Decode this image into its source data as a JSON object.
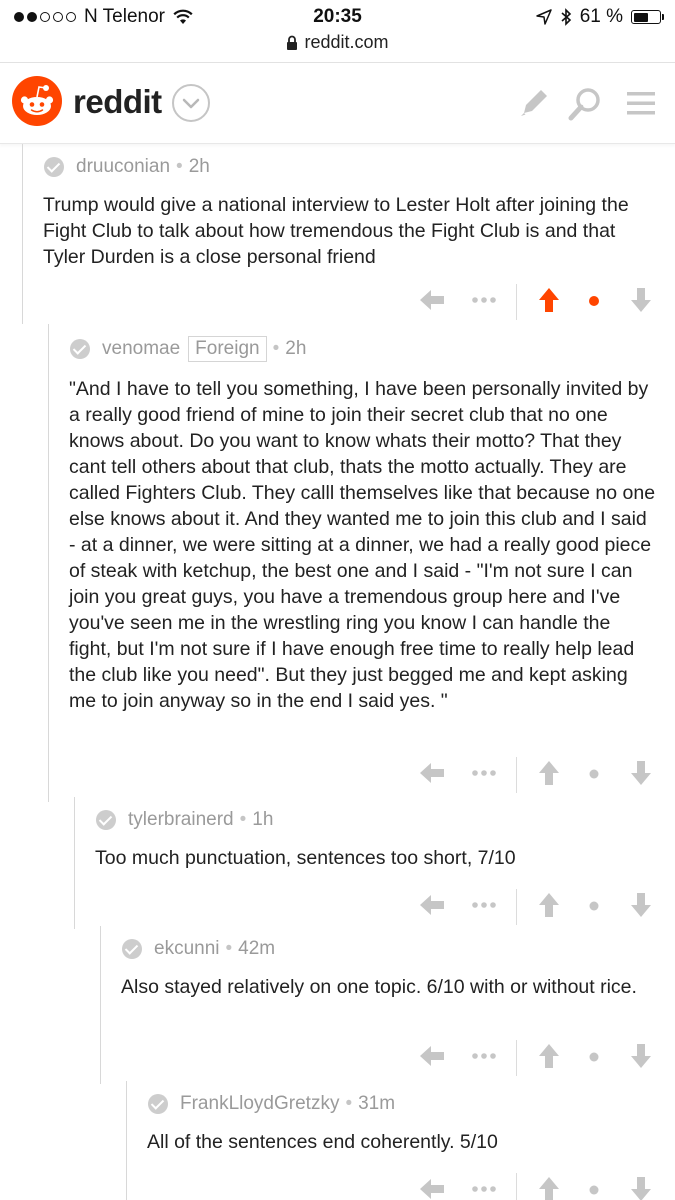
{
  "status_bar": {
    "carrier": "N Telenor",
    "time": "20:35",
    "battery": "61 %",
    "battery_level": 0.61
  },
  "url": "reddit.com",
  "header": {
    "brand": "reddit",
    "icons": [
      "reddit-alien-logo",
      "chevron-down-icon",
      "pencil-icon",
      "search-icon",
      "menu-icon"
    ]
  },
  "comments": [
    {
      "author": "druuconian",
      "flair": "",
      "age": "2h",
      "body": "Trump would give a national interview to Lester Holt after joining the Fight Club to talk about how tremendous the Fight Club is and that Tyler Durden is a close personal friend",
      "upvoted": true
    },
    {
      "author": "venomae",
      "flair": "Foreign",
      "age": "2h",
      "body": "\"And I have to tell you something, I have been personally invited by a really good friend of mine to join their secret club that no one knows about. Do you want to know whats their motto? That they cant tell others about that club, thats the motto actually. They are called Fighters Club. They calll themselves like that because no one else knows about it. And they wanted me to join this club and I said - at a dinner, we were sitting at a dinner, we had a really good piece of steak with ketchup, the best one and I said - \"I'm not sure I can join you great guys, you have a tremendous group here and I've you've seen me in the wrestling ring you know I can handle the fight, but I'm not sure if I have enough free time to really help lead the club like you need\". But they just begged me and kept asking me to join anyway so in the end I said yes. \"",
      "upvoted": false
    },
    {
      "author": "tylerbrainerd",
      "flair": "",
      "age": "1h",
      "body": "Too much punctuation, sentences too short, 7/10",
      "upvoted": false
    },
    {
      "author": "ekcunni",
      "flair": "",
      "age": "42m",
      "body": "Also stayed relatively on one topic. 6/10 with or without rice.",
      "upvoted": false
    },
    {
      "author": "FrankLloydGretzky",
      "flair": "",
      "age": "31m",
      "body": "All of the sentences end coherently. 5/10",
      "upvoted": false
    }
  ],
  "colors": {
    "accent": "#ff4500",
    "icon_gray": "#c6c6c6",
    "meta_gray": "#9a9a9a"
  }
}
